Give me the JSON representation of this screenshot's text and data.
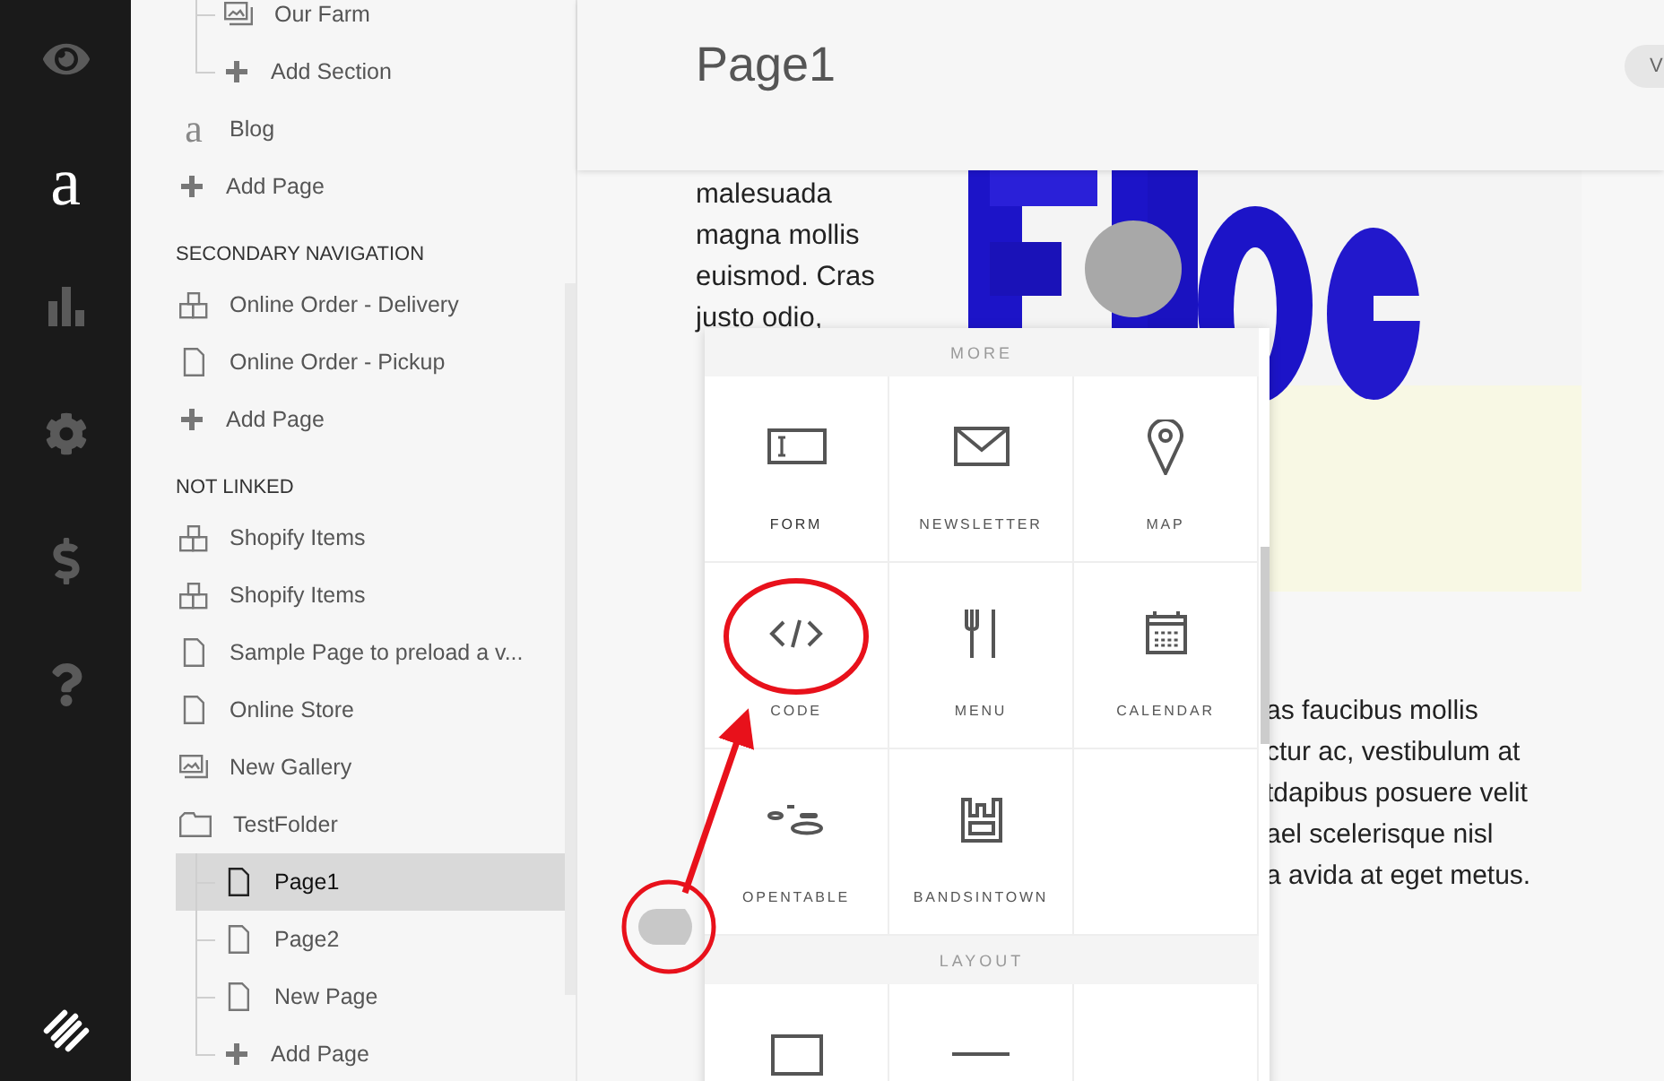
{
  "rail": {
    "items": [
      {
        "kind": "eye",
        "selected": false
      },
      {
        "kind": "glyph",
        "glyph": "a",
        "selected": true
      },
      {
        "kind": "chart",
        "selected": false
      },
      {
        "kind": "gear",
        "selected": false
      },
      {
        "kind": "dollar",
        "selected": false
      },
      {
        "kind": "help",
        "selected": false
      }
    ]
  },
  "sidebar": {
    "sections": [
      {
        "items": [
          {
            "kind": "continued",
            "children": [
              {
                "kind": "gallery",
                "label": "Our Farm",
                "selected": false
              },
              {
                "kind": "add",
                "label": "Add Section",
                "selected": false
              }
            ]
          },
          {
            "kind": "blog",
            "glyph": "a",
            "label": "Blog",
            "selected": false
          },
          {
            "kind": "add",
            "label": "Add Page",
            "selected": false
          }
        ]
      },
      {
        "heading": "SECONDARY NAVIGATION",
        "items": [
          {
            "kind": "product",
            "label": "Online Order - Delivery",
            "selected": false
          },
          {
            "kind": "page",
            "label": "Online Order - Pickup",
            "selected": false
          },
          {
            "kind": "add",
            "label": "Add Page",
            "selected": false
          }
        ]
      },
      {
        "heading": "NOT LINKED",
        "items": [
          {
            "kind": "product",
            "label": "Shopify Items",
            "selected": false
          },
          {
            "kind": "product",
            "label": "Shopify Items",
            "selected": false
          },
          {
            "kind": "page",
            "label": "Sample Page to preload a v...",
            "selected": false
          },
          {
            "kind": "page",
            "label": "Online Store",
            "selected": false
          },
          {
            "kind": "gallery",
            "label": "New Gallery",
            "selected": false
          },
          {
            "kind": "folder",
            "label": "TestFolder",
            "selected": false,
            "children": [
              {
                "kind": "page",
                "label": "Page1",
                "selected": true
              },
              {
                "kind": "page",
                "label": "Page2",
                "selected": false
              },
              {
                "kind": "page",
                "label": "New Page",
                "selected": false
              },
              {
                "kind": "add",
                "label": "Add Page",
                "selected": false
              }
            ]
          }
        ]
      }
    ]
  },
  "header": {
    "title": "Page1",
    "button": "V"
  },
  "content": {
    "left_text": [
      "malesuada",
      "magna mollis",
      "euismod. Cras",
      "justo odio,"
    ],
    "image": {
      "kind": "picture"
    },
    "right_text": [
      "as faucibus mollis",
      "ctur ac, vestibulum at",
      "tdapibus posuere velit",
      "ael scelerisque nisl",
      "a avida at eget metus."
    ]
  },
  "popup": {
    "sections": [
      {
        "title": "MORE",
        "blocks": [
          {
            "kind": "form",
            "label": "FORM"
          },
          {
            "kind": "newsletter",
            "label": "NEWSLETTER"
          },
          {
            "kind": "map",
            "label": "MAP"
          },
          {
            "kind": "code",
            "label": "CODE"
          },
          {
            "kind": "menu",
            "label": "MENU"
          },
          {
            "kind": "calendar",
            "label": "CALENDAR"
          },
          {
            "kind": "opentable",
            "label": "OPENTABLE"
          },
          {
            "kind": "bandsintown",
            "label": "BANDSINTOWN"
          },
          {
            "kind": "empty"
          }
        ]
      },
      {
        "title": "LAYOUT",
        "blocks": [
          {
            "kind": "spacer"
          },
          {
            "kind": "line"
          },
          {
            "kind": "empty"
          }
        ]
      }
    ]
  }
}
